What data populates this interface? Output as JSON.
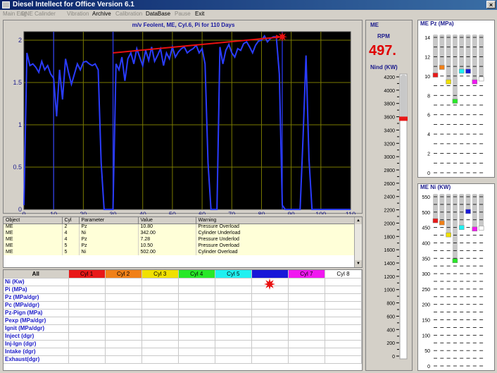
{
  "window": {
    "title": "Diesel Intellect for Office    Version 6.1",
    "close_glyph": "×"
  },
  "menu": [
    {
      "label": "Main Eng",
      "enabled": false
    },
    {
      "label": "DNE Calinder",
      "enabled": false
    },
    {
      "label": "Vibration",
      "enabled": false
    },
    {
      "label": "Archive",
      "enabled": true
    },
    {
      "label": "Calibration",
      "enabled": false
    },
    {
      "label": "DataBase",
      "enabled": true
    },
    {
      "label": "Pause",
      "enabled": false
    },
    {
      "label": "Exit",
      "enabled": true
    }
  ],
  "chart_data": {
    "type": "line",
    "title": "m/v Feolent,  ME,  Cyl.6,  Pi  for 110 Days",
    "xlim": [
      0,
      110
    ],
    "ylim": [
      0,
      2.1
    ],
    "x_ticks": [
      0,
      10,
      20,
      30,
      40,
      50,
      60,
      70,
      80,
      90,
      100,
      110
    ],
    "y_ticks": [
      0,
      0.5,
      1,
      1.5,
      2
    ],
    "y_tick_labels": [
      "0",
      "0.5",
      "1",
      "1.5",
      "2"
    ],
    "grid": true,
    "series": [
      {
        "color": "#2a3cff",
        "x": [
          0,
          1,
          2,
          3,
          4,
          5,
          6,
          7,
          8,
          9,
          10,
          11,
          12,
          13,
          14,
          15,
          16,
          17,
          18,
          19,
          20,
          21,
          22,
          23,
          24,
          25,
          26,
          27,
          28,
          29,
          30,
          31,
          32,
          33,
          34,
          35,
          36,
          37,
          38,
          39,
          40,
          41,
          42,
          43,
          44,
          45,
          46,
          47,
          48,
          49,
          50,
          51,
          52,
          53,
          54,
          55,
          56,
          57,
          58,
          59,
          60,
          61,
          62,
          63,
          64,
          65,
          66,
          67,
          68,
          69,
          70,
          71,
          72,
          73,
          74,
          75,
          76,
          77,
          78,
          79,
          80,
          81,
          82,
          83,
          84,
          85,
          86,
          87,
          88,
          89,
          90,
          91,
          92,
          93,
          94,
          95,
          96,
          97,
          98,
          99,
          100,
          101,
          102,
          103,
          104,
          105,
          106,
          107,
          108,
          109,
          110
        ],
        "y": [
          0.05,
          1.85,
          1.7,
          1.72,
          1.68,
          1.62,
          1.75,
          1.65,
          1.7,
          1.6,
          1.55,
          1.1,
          1.65,
          1.3,
          1.78,
          1.62,
          1.48,
          1.6,
          1.72,
          1.65,
          1.74,
          1.75,
          1.72,
          1.7,
          1.72,
          1.65,
          0.55,
          0,
          0,
          0,
          0,
          1.72,
          1.65,
          1.8,
          1.52,
          1.78,
          1.85,
          1.72,
          1.9,
          1.8,
          1.7,
          1.88,
          1.76,
          1.92,
          1.75,
          1.82,
          1.9,
          1.7,
          1.85,
          1.78,
          1.92,
          1.8,
          1.86,
          1.9,
          1.92,
          1.85,
          1.88,
          1.9,
          1.94,
          1.85,
          1.9,
          1.72,
          0.55,
          0,
          0,
          0,
          1.92,
          1.72,
          1.88,
          1.95,
          1.85,
          1.8,
          1.9,
          1.88,
          1.96,
          1.98,
          1.92,
          1.85,
          1.94,
          1.99,
          2.0,
          2.05,
          1.98,
          2.02,
          2.04,
          2.04,
          1.6,
          0.05,
          0,
          0,
          0,
          0,
          0,
          0,
          0.85,
          1.82,
          0.6,
          0,
          0,
          0,
          0,
          0,
          0,
          0,
          0,
          0,
          0,
          0,
          0,
          0,
          0
        ]
      }
    ],
    "trend_line": {
      "x": [
        30,
        87
      ],
      "y": [
        1.85,
        2.04
      ],
      "color": "#e81010"
    },
    "marker": {
      "x": 87,
      "y": 2.04,
      "color": "#e81010"
    },
    "background": "#000000"
  },
  "warnings": {
    "columns": [
      "Object",
      "Cyl",
      "Parameter",
      "Value",
      "Warning"
    ],
    "rows": [
      [
        "ME",
        "2",
        "Pz",
        "10.80",
        "Pressure Overload"
      ],
      [
        "ME",
        "4",
        "Ni",
        "342.00",
        "Cylinder Underload"
      ],
      [
        "ME",
        "4",
        "Pz",
        "7.28",
        "Pressure Underlod"
      ],
      [
        "ME",
        "5",
        "Pz",
        "10.50",
        "Pressure Overload"
      ],
      [
        "ME",
        "5",
        "Ni",
        "502.00",
        "Cylinder Overload"
      ]
    ]
  },
  "cylinder_table": {
    "all_label": "All",
    "cylinders": [
      {
        "label": "Cyl 1",
        "color": "#e81818"
      },
      {
        "label": "Cyl 2",
        "color": "#f08018"
      },
      {
        "label": "Cyl 3",
        "color": "#f0e000"
      },
      {
        "label": "Cyl 4",
        "color": "#28e828"
      },
      {
        "label": "Cyl 5",
        "color": "#20f0f0"
      },
      {
        "label": "Cyl 6",
        "color": "#1818d8"
      },
      {
        "label": "Cyl 7",
        "color": "#f018f0"
      },
      {
        "label": "Cyl 8",
        "color": "#ffffff"
      }
    ],
    "selected_cylinder": 6,
    "parameters": [
      "Ni   (Kw)",
      "Pi   (MPa)",
      "Pz   (MPa/dgr)",
      "Pc   (MPa/dgr)",
      "Pz-Pign   (MPa)",
      "Pexp   (MPa/dgr)",
      "Ignit  (MPa/dgr)",
      "Inject (dgr)",
      "Inj-Ign  (dgr)",
      "Intake (dgr)",
      "Exhaust(dgr)"
    ]
  },
  "me": {
    "label": "ME",
    "rpm_label": "RPM",
    "rpm_value": "497.",
    "nind_label": "Nind (KW)",
    "nind_scale": [
      4200,
      4000,
      3800,
      3600,
      3400,
      3200,
      3000,
      2800,
      2600,
      2400,
      2200,
      2000,
      1800,
      1600,
      1400,
      1200,
      1000,
      800,
      600,
      400,
      200,
      0
    ],
    "nind_max": 4200,
    "nind_value": 3570
  },
  "pz": {
    "label": "ME Pz  (MPa)",
    "scale": [
      14,
      12,
      10,
      8,
      6,
      4,
      2,
      0
    ],
    "max": 14,
    "values": [
      10.1,
      10.9,
      9.4,
      7.4,
      10.5,
      10.5,
      9.4,
      9.7
    ]
  },
  "ni": {
    "label": "ME Ni  (KW)",
    "scale": [
      550,
      500,
      450,
      400,
      350,
      300,
      250,
      200,
      150,
      100,
      50,
      0
    ],
    "max": 550,
    "values": [
      472,
      465,
      426,
      342,
      450,
      502,
      445,
      448
    ]
  }
}
